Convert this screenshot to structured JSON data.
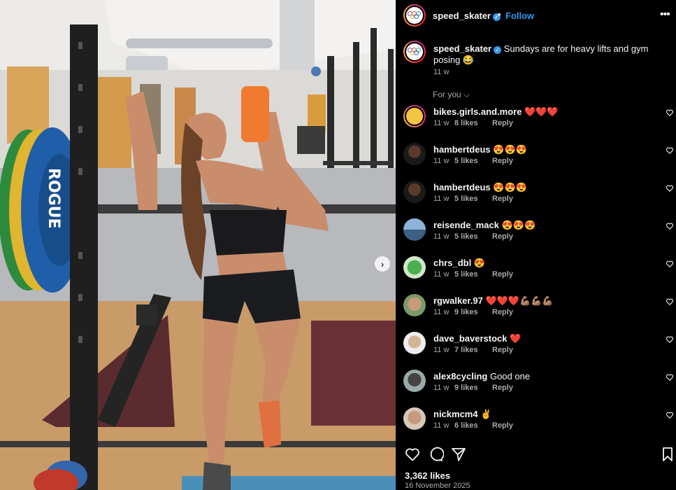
{
  "post": {
    "username": "speed_skater",
    "verified": true,
    "follow_label": "Follow",
    "separator": "•",
    "more_icon": "more-horizontal-icon"
  },
  "caption": {
    "username": "speed_skater",
    "text": "Sundays are for heavy lifts and gym posing 😂",
    "time": "11 w"
  },
  "filter": {
    "label": "For you",
    "icon": "chevron-down-icon"
  },
  "comments": [
    {
      "user": "bikes.girls.and.more",
      "text": "❤️❤️❤️",
      "time": "11 w",
      "likes": "8 likes",
      "reply": "Reply"
    },
    {
      "user": "hambertdeus",
      "text": "😍😍😍",
      "time": "11 w",
      "likes": "5 likes",
      "reply": "Reply"
    },
    {
      "user": "hambertdeus",
      "text": "😍😍😍",
      "time": "11 w",
      "likes": "5 likes",
      "reply": "Reply"
    },
    {
      "user": "reisende_mack",
      "text": "😍😍😍",
      "time": "11 w",
      "likes": "5 likes",
      "reply": "Reply"
    },
    {
      "user": "chrs_dbl",
      "text": "😍",
      "time": "11 w",
      "likes": "5 likes",
      "reply": "Reply"
    },
    {
      "user": "rgwalker.97",
      "text": "❤️❤️❤️💪🏽💪🏽💪🏽",
      "time": "11 w",
      "likes": "9 likes",
      "reply": "Reply"
    },
    {
      "user": "dave_baverstock",
      "text": "❤️",
      "time": "11 w",
      "likes": "7 likes",
      "reply": "Reply"
    },
    {
      "user": "alex8cycling",
      "text": "Good one",
      "time": "11 w",
      "likes": "9 likes",
      "reply": "Reply"
    },
    {
      "user": "nickmcm4",
      "text": "✌️",
      "time": "11 w",
      "likes": "6 likes",
      "reply": "Reply"
    }
  ],
  "footer": {
    "likes": "3,362 likes",
    "date": "16 November 2025"
  },
  "colors": {
    "accent": "#3797f0",
    "background": "#000000",
    "muted": "#a8a8a8",
    "like_red": "#ff3040"
  }
}
